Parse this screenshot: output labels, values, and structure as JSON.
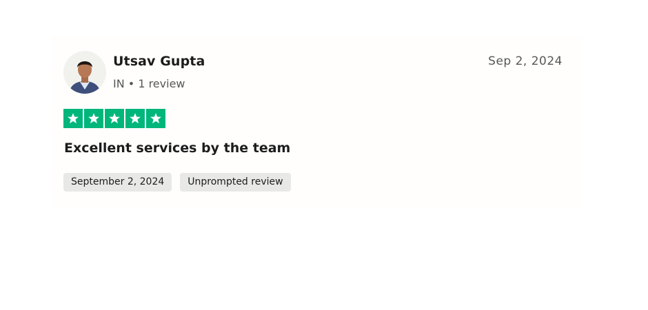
{
  "review": {
    "reviewer": {
      "name": "Utsav Gupta",
      "country": "IN",
      "separator": "•",
      "review_count": "1 review",
      "avatar_icon": "user-avatar-photo"
    },
    "date": "Sep 2, 2024",
    "rating": {
      "stars": 5,
      "max": 5,
      "color": "#00b67a",
      "icon": "star-icon"
    },
    "title": "Excellent services by the team",
    "tags": {
      "experience_date": "September 2, 2024",
      "review_type": "Unprompted review"
    }
  }
}
